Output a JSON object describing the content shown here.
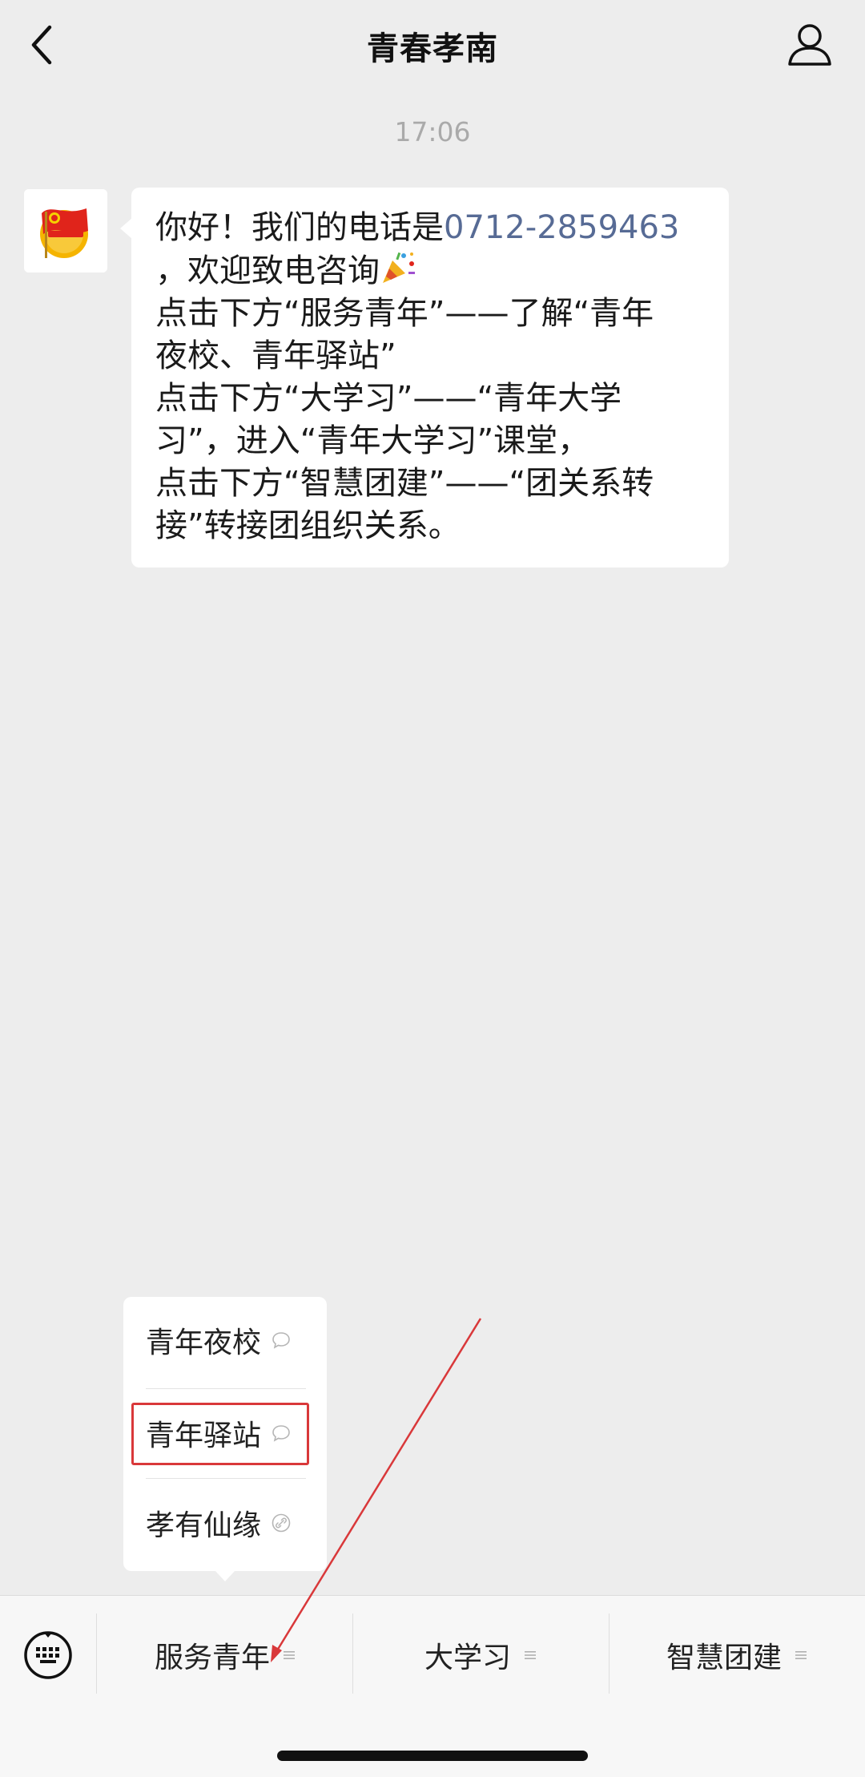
{
  "header": {
    "title": "青春孝南",
    "back_icon": "chevron-left-icon",
    "profile_icon": "person-icon"
  },
  "timestamp": "17:06",
  "message": {
    "avatar_icon": "youth-league-emblem-icon",
    "line1_prefix": "你好！我们的电话是",
    "phone": "0712-2859463",
    "line2": "，欢迎致电咨询",
    "emoji_icon": "party-popper-icon",
    "line3": "点击下方“服务青年”——了解“青年",
    "line4": "夜校、青年驿站”",
    "line5": "点击下方“大学习”——“青年大学",
    "line6": "习”，进入“青年大学习”课堂，",
    "line7": "点击下方“智慧团建”——“团关系转",
    "line8": "接”转接团组织关系。"
  },
  "popup_menu": {
    "items": [
      {
        "label": "青年夜校",
        "icon": "chat-bubble-icon"
      },
      {
        "label": "青年驿站",
        "icon": "chat-bubble-icon"
      },
      {
        "label": "孝有仙缘",
        "icon": "link-icon"
      }
    ],
    "highlighted_item": "青年驿站"
  },
  "bottom_menu": {
    "keyboard_icon": "keyboard-icon",
    "items": [
      {
        "label": "服务青年",
        "icon": "menu-lines-icon"
      },
      {
        "label": "大学习",
        "icon": "menu-lines-icon"
      },
      {
        "label": "智慧团建",
        "icon": "menu-lines-icon"
      }
    ]
  },
  "colors": {
    "background": "#ededed",
    "link": "#576b95",
    "annotation": "#d9383a"
  }
}
